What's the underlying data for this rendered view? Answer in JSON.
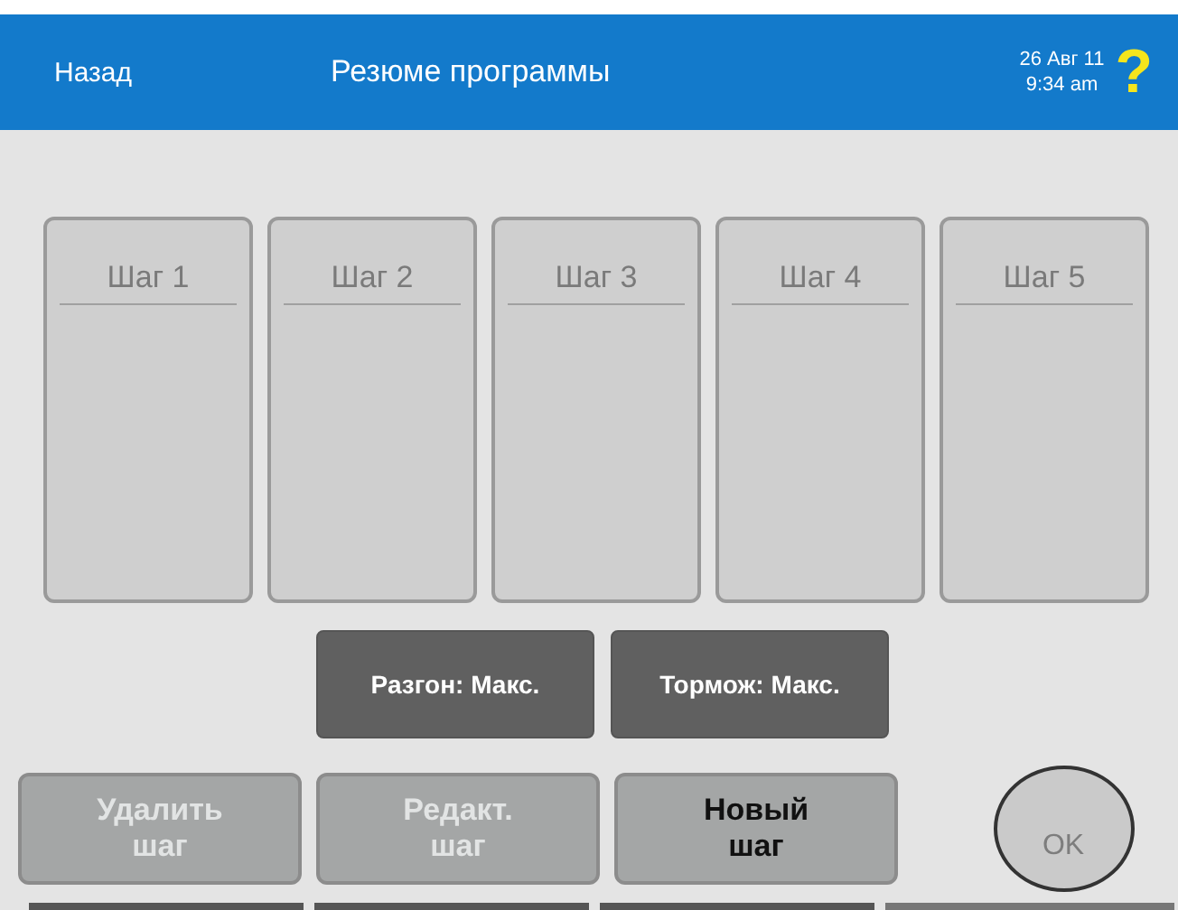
{
  "header": {
    "back": "Назад",
    "title": "Резюме программы",
    "date": "26 Авг 11",
    "time": "9:34 am",
    "help": "?"
  },
  "steps": [
    {
      "label": "Шаг 1"
    },
    {
      "label": "Шаг 2"
    },
    {
      "label": "Шаг 3"
    },
    {
      "label": "Шаг 4"
    },
    {
      "label": "Шаг 5"
    }
  ],
  "settings": [
    "Разгон: Макс.",
    "Тормож: Макс."
  ],
  "actions": [
    {
      "label": "Удалить шаг",
      "disabled": true
    },
    {
      "label": "Редакт. шаг",
      "disabled": true
    },
    {
      "label": "Новый шаг",
      "disabled": false
    }
  ],
  "ok": {
    "label": "OK",
    "disabled": true
  }
}
